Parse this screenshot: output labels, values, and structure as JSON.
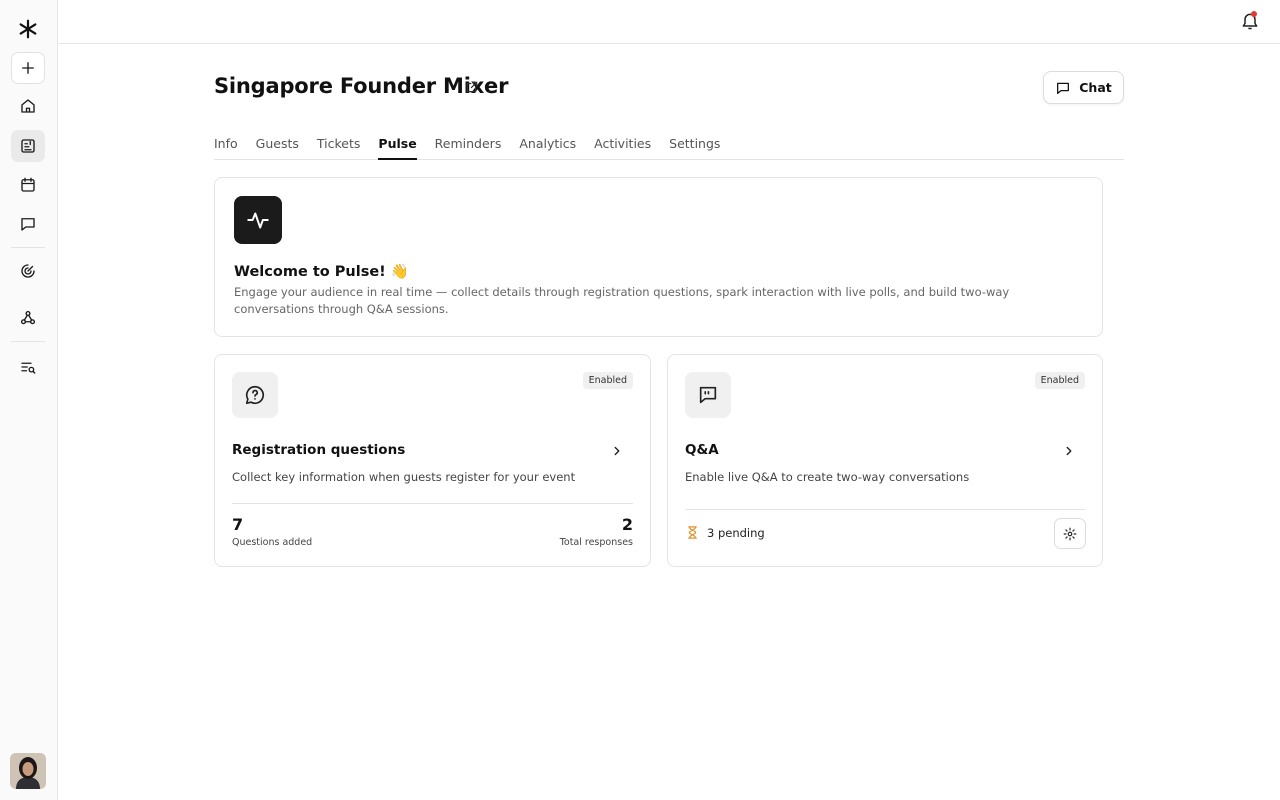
{
  "sidebar": {
    "logo": "brand-logo-icon",
    "items": [
      {
        "icon": "plus-icon",
        "name": "create"
      },
      {
        "icon": "home-icon",
        "name": "home"
      },
      {
        "icon": "event-list-icon",
        "name": "events",
        "active": true
      },
      {
        "icon": "calendar-icon",
        "name": "calendar"
      },
      {
        "icon": "message-icon",
        "name": "messages"
      },
      {
        "icon": "radar-icon",
        "name": "discover"
      },
      {
        "icon": "webhook-icon",
        "name": "integrations"
      },
      {
        "icon": "list-search-icon",
        "name": "search-list"
      }
    ],
    "avatar": "user-avatar"
  },
  "topbar": {
    "notification_icon": "bell-icon",
    "has_unread": true,
    "unread_color": "#e53935"
  },
  "header": {
    "title": "Singapore Founder Mixer",
    "chat_label": "Chat"
  },
  "tabs": [
    {
      "label": "Info"
    },
    {
      "label": "Guests"
    },
    {
      "label": "Tickets"
    },
    {
      "label": "Pulse",
      "active": true
    },
    {
      "label": "Reminders"
    },
    {
      "label": "Analytics"
    },
    {
      "label": "Activities"
    },
    {
      "label": "Settings"
    }
  ],
  "welcome": {
    "title": "Welcome to Pulse! 👋",
    "description": "Engage your audience in real time — collect details through registration questions, spark interaction with live polls, and build two-way conversations through Q&A sessions."
  },
  "registration": {
    "badge": "Enabled",
    "title": "Registration questions",
    "description": "Collect key information when guests register for your event",
    "questions_added": "7",
    "questions_label": "Questions added",
    "total_responses": "2",
    "responses_label": "Total responses"
  },
  "qa": {
    "badge": "Enabled",
    "title": "Q&A",
    "description": "Enable live Q&A to create two-way conversations",
    "pending": "3 pending",
    "pending_color": "#e0922b"
  }
}
